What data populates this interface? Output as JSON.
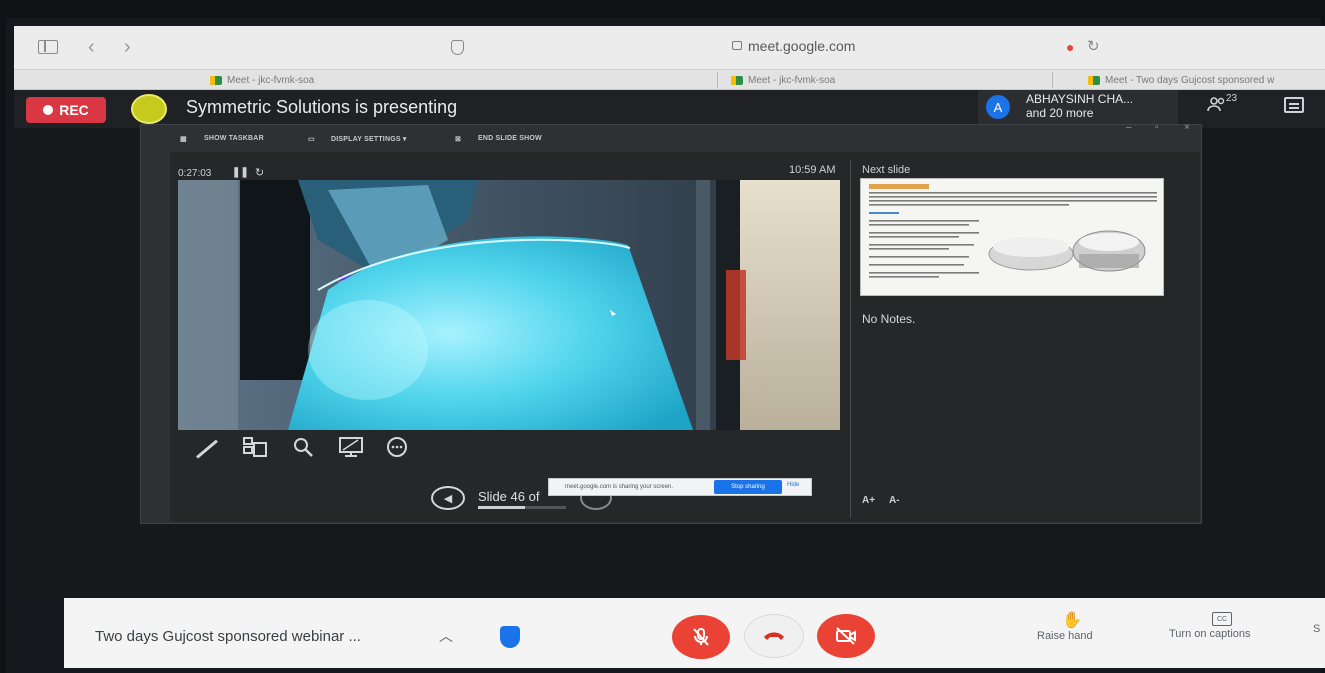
{
  "browser": {
    "url": "meet.google.com",
    "nav_back": "‹",
    "nav_forward": "›",
    "reload": "↻",
    "mic": "●",
    "tabs": [
      {
        "label": "Meet - jkc-fvmk-soa"
      },
      {
        "label": "Meet - jkc-fvmk-soa"
      },
      {
        "label": "Meet - Two days Gujcost sponsored w"
      }
    ]
  },
  "meet_header": {
    "rec_label": "REC",
    "presenting_text": "Symmetric Solutions is presenting",
    "participant_initial": "A",
    "participant_name": "ABHAYSINH CHA...",
    "participant_more": "and 20 more",
    "people_count": "23"
  },
  "presenter_view": {
    "toolbar": {
      "show_taskbar": "SHOW TASKBAR",
      "display_settings": "DISPLAY SETTINGS ▾",
      "end_slide_show": "END SLIDE SHOW"
    },
    "window_controls": [
      "–",
      "▫",
      "×"
    ],
    "timer": "0:27:03",
    "pause_glyph": "❚❚",
    "restart_glyph": "↻",
    "clock": "10:59 AM",
    "next_slide_label": "Next slide",
    "notes": "No Notes.",
    "slide_counter": "Slide 46 of",
    "slide_progress_fraction": 0.53,
    "prev_glyph": "◀",
    "font_increase": "A+",
    "font_decrease": "A-"
  },
  "share_notice": {
    "text": "meet.google.com is sharing your screen.",
    "stop_label": "Stop sharing",
    "hide_label": "Hide"
  },
  "bottom_bar": {
    "meeting_title": "Two days Gujcost sponsored webinar ...",
    "chevron": "︿",
    "raise_hand_label": "Raise hand",
    "captions_label": "Turn on captions",
    "cc_glyph": "CC",
    "overflow_letter": "S"
  },
  "colors": {
    "rec_red": "#d93744",
    "meet_red": "#ea4335",
    "accent_blue": "#1a73e8",
    "dark_bg": "#202124"
  }
}
